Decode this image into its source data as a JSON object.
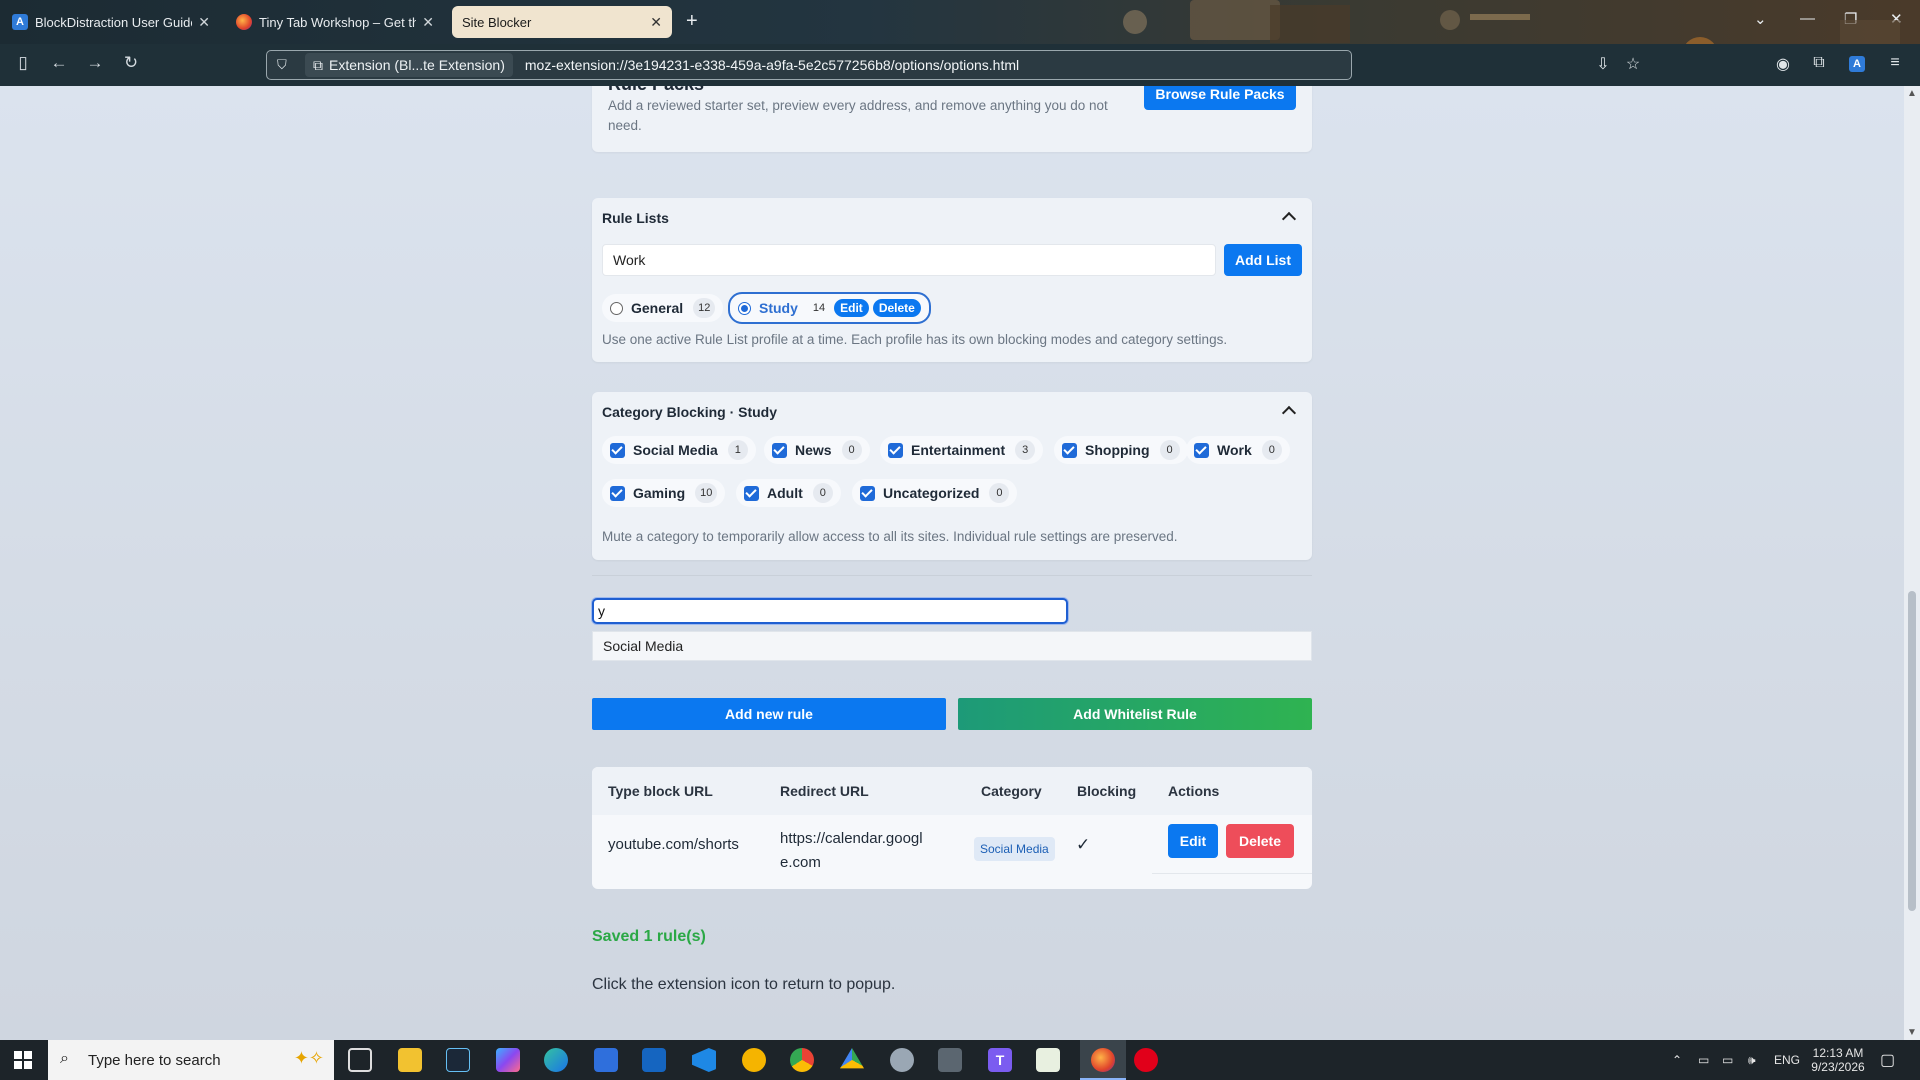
{
  "browser": {
    "tabs": [
      {
        "title": "BlockDistraction User Guide: Ru",
        "favicon": "blockdistraction-icon"
      },
      {
        "title": "Tiny Tab Workshop – Get this Tl",
        "favicon": "firefox-icon"
      },
      {
        "title": "Site Blocker",
        "favicon": ""
      }
    ],
    "identity_chip": "Extension (Bl...te Extension)",
    "url": "moz-extension://3e194231-e338-459a-a9fa-5e2c577256b8/options/options.html"
  },
  "rule_packs": {
    "title": "Rule Packs",
    "description": "Add a reviewed starter set, preview every address, and remove anything you do not need.",
    "browse_label": "Browse Rule Packs"
  },
  "rule_lists": {
    "title": "Rule Lists",
    "input_value": "Work",
    "add_label": "Add List",
    "lists": [
      {
        "name": "General",
        "count": "12",
        "selected": false
      },
      {
        "name": "Study",
        "count": "14",
        "selected": true
      }
    ],
    "edit_label": "Edit",
    "delete_label": "Delete",
    "help": "Use one active Rule List profile at a time. Each profile has its own blocking modes and category settings."
  },
  "category_blocking": {
    "title": "Category Blocking · Study",
    "categories": [
      {
        "name": "Social Media",
        "count": "1"
      },
      {
        "name": "News",
        "count": "0"
      },
      {
        "name": "Entertainment",
        "count": "3"
      },
      {
        "name": "Shopping",
        "count": "0"
      },
      {
        "name": "Work",
        "count": "0"
      },
      {
        "name": "Gaming",
        "count": "10"
      },
      {
        "name": "Adult",
        "count": "0"
      },
      {
        "name": "Uncategorized",
        "count": "0"
      }
    ],
    "help": "Mute a category to temporarily allow access to all its sites. Individual rule settings are preserved."
  },
  "rule_form": {
    "input_value": "y",
    "category_value": "Social Media",
    "add_rule_label": "Add new rule",
    "add_whitelist_label": "Add Whitelist Rule"
  },
  "rules_table": {
    "headers": [
      "Type block URL",
      "Redirect URL",
      "Category",
      "Blocking",
      "Actions"
    ],
    "rows": [
      {
        "block_url": "youtube.com/shorts",
        "redirect_line1": "https://calendar.googl",
        "redirect_line2": "e.com",
        "category": "Social Media",
        "blocking": "✓",
        "edit": "Edit",
        "delete": "Delete"
      }
    ]
  },
  "status": {
    "saved": "Saved 1 rule(s)",
    "footer": "Click the extension icon to return to popup."
  },
  "taskbar": {
    "search_placeholder": "Type here to search",
    "language": "ENG",
    "time": "12:13 AM",
    "date": "9/23/2026"
  },
  "colors": {
    "primary": "#0b78f0",
    "success": "#24a148",
    "danger": "#ee4d5a",
    "saved_text": "#2aa845"
  }
}
